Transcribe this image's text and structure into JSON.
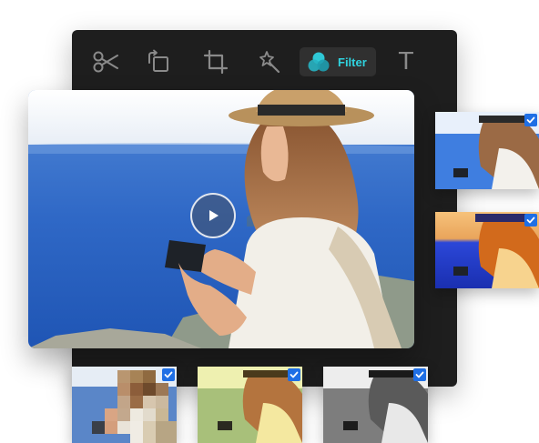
{
  "toolbar": {
    "tools": [
      {
        "name": "scissors-icon"
      },
      {
        "name": "rotate-icon"
      },
      {
        "name": "crop-icon"
      },
      {
        "name": "magic-wand-icon"
      },
      {
        "name": "filter-icon"
      },
      {
        "name": "text-icon"
      }
    ],
    "filter_label": "Filter",
    "text_tool_glyph": "T"
  },
  "colors": {
    "panel_bg": "#1e1e1e",
    "filter_accent": "#2fd3df",
    "check_blue": "#1f6fe5"
  },
  "preview": {
    "play_icon": "play-icon"
  },
  "filters": [
    {
      "name": "pixelate",
      "selected": true
    },
    {
      "name": "warm-yellow",
      "selected": true
    },
    {
      "name": "grayscale",
      "selected": true
    },
    {
      "name": "cool-blue",
      "selected": true
    },
    {
      "name": "sunset-vivid",
      "selected": true
    }
  ]
}
